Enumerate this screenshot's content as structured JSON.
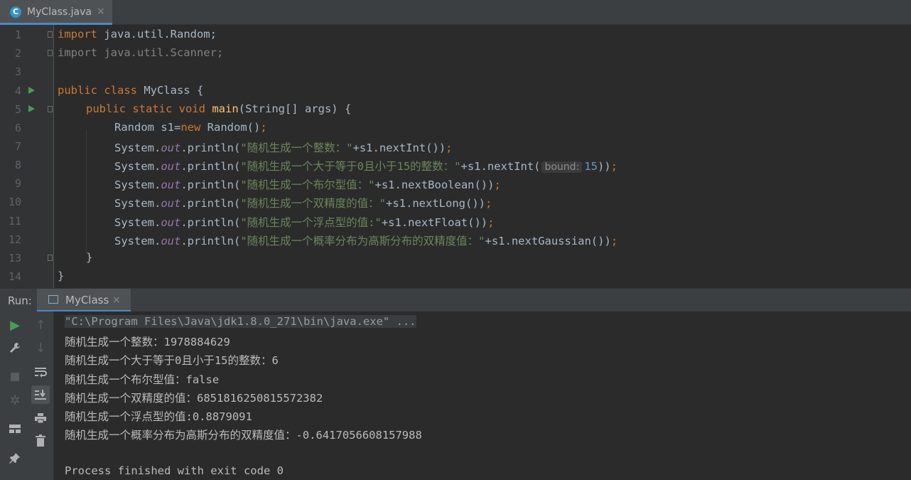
{
  "editor_tab": {
    "label": "MyClass.java",
    "close": "×",
    "icon": "java-class-icon"
  },
  "line_numbers": [
    "1",
    "2",
    "3",
    "4",
    "5",
    "6",
    "7",
    "8",
    "9",
    "10",
    "11",
    "12",
    "13",
    "14"
  ],
  "code": {
    "l1_kw": "import",
    "l1_rest": " java.util.Random;",
    "l2": "import java.util.Scanner;",
    "l4_kw": "public class",
    "l4_rest": " MyClass {",
    "l5_kw": "public static void",
    "l5_method": "main",
    "l5_rest": "(String[] args) {",
    "l6_a": "Random s1=",
    "l6_kw": "new",
    "l6_b": " Random()",
    "l6_semi": ";",
    "sys": "System.",
    "out": "out",
    "println": ".println(",
    "s7": "\"随机生成一个整数：\"",
    "c7": "+s1.nextInt())",
    "s8": "\"随机生成一个大于等于0且小于15的整数：\"",
    "c8a": "+s1.nextInt(",
    "hint8": "bound:",
    "n8": "15",
    "c8b": "))",
    "s9": "\"随机生成一个布尔型值：\"",
    "c9": "+s1.nextBoolean())",
    "s10": "\"随机生成一个双精度的值：\"",
    "c10": "+s1.nextLong())",
    "s11": "\"随机生成一个浮点型的值:\"",
    "c11": "+s1.nextFloat())",
    "s12": "\"随机生成一个概率分布为高斯分布的双精度值：\"",
    "c12": "+s1.nextGaussian())",
    "semi": ";",
    "l13": "}",
    "l14": "}"
  },
  "run_panel": {
    "label": "Run:",
    "tab": "MyClass",
    "close": "×"
  },
  "toolbar_icons": [
    "run-icon",
    "wrench-icon",
    "stop-icon",
    "debug-icon",
    "layout-icon",
    "pin-icon",
    "up-arrow-icon",
    "down-arrow-icon",
    "soft-wrap-icon",
    "scroll-to-end-icon",
    "print-icon",
    "trash-icon"
  ],
  "console": {
    "command": "\"C:\\Program Files\\Java\\jdk1.8.0_271\\bin\\java.exe\" ...",
    "lines": [
      "随机生成一个整数：1978884629",
      "随机生成一个大于等于0且小于15的整数：6",
      "随机生成一个布尔型值：false",
      "随机生成一个双精度的值：6851816250815572382",
      "随机生成一个浮点型的值:0.8879091",
      "随机生成一个概率分布为高斯分布的双精度值：-0.6417056608157988"
    ],
    "exit": "Process finished with exit code 0"
  },
  "colors": {
    "background": "#2b2b2b",
    "keyword": "#cc7832",
    "string": "#6a8759",
    "field": "#9876aa",
    "number": "#6897bb",
    "method": "#ffc66d",
    "run_green": "#499c54"
  }
}
